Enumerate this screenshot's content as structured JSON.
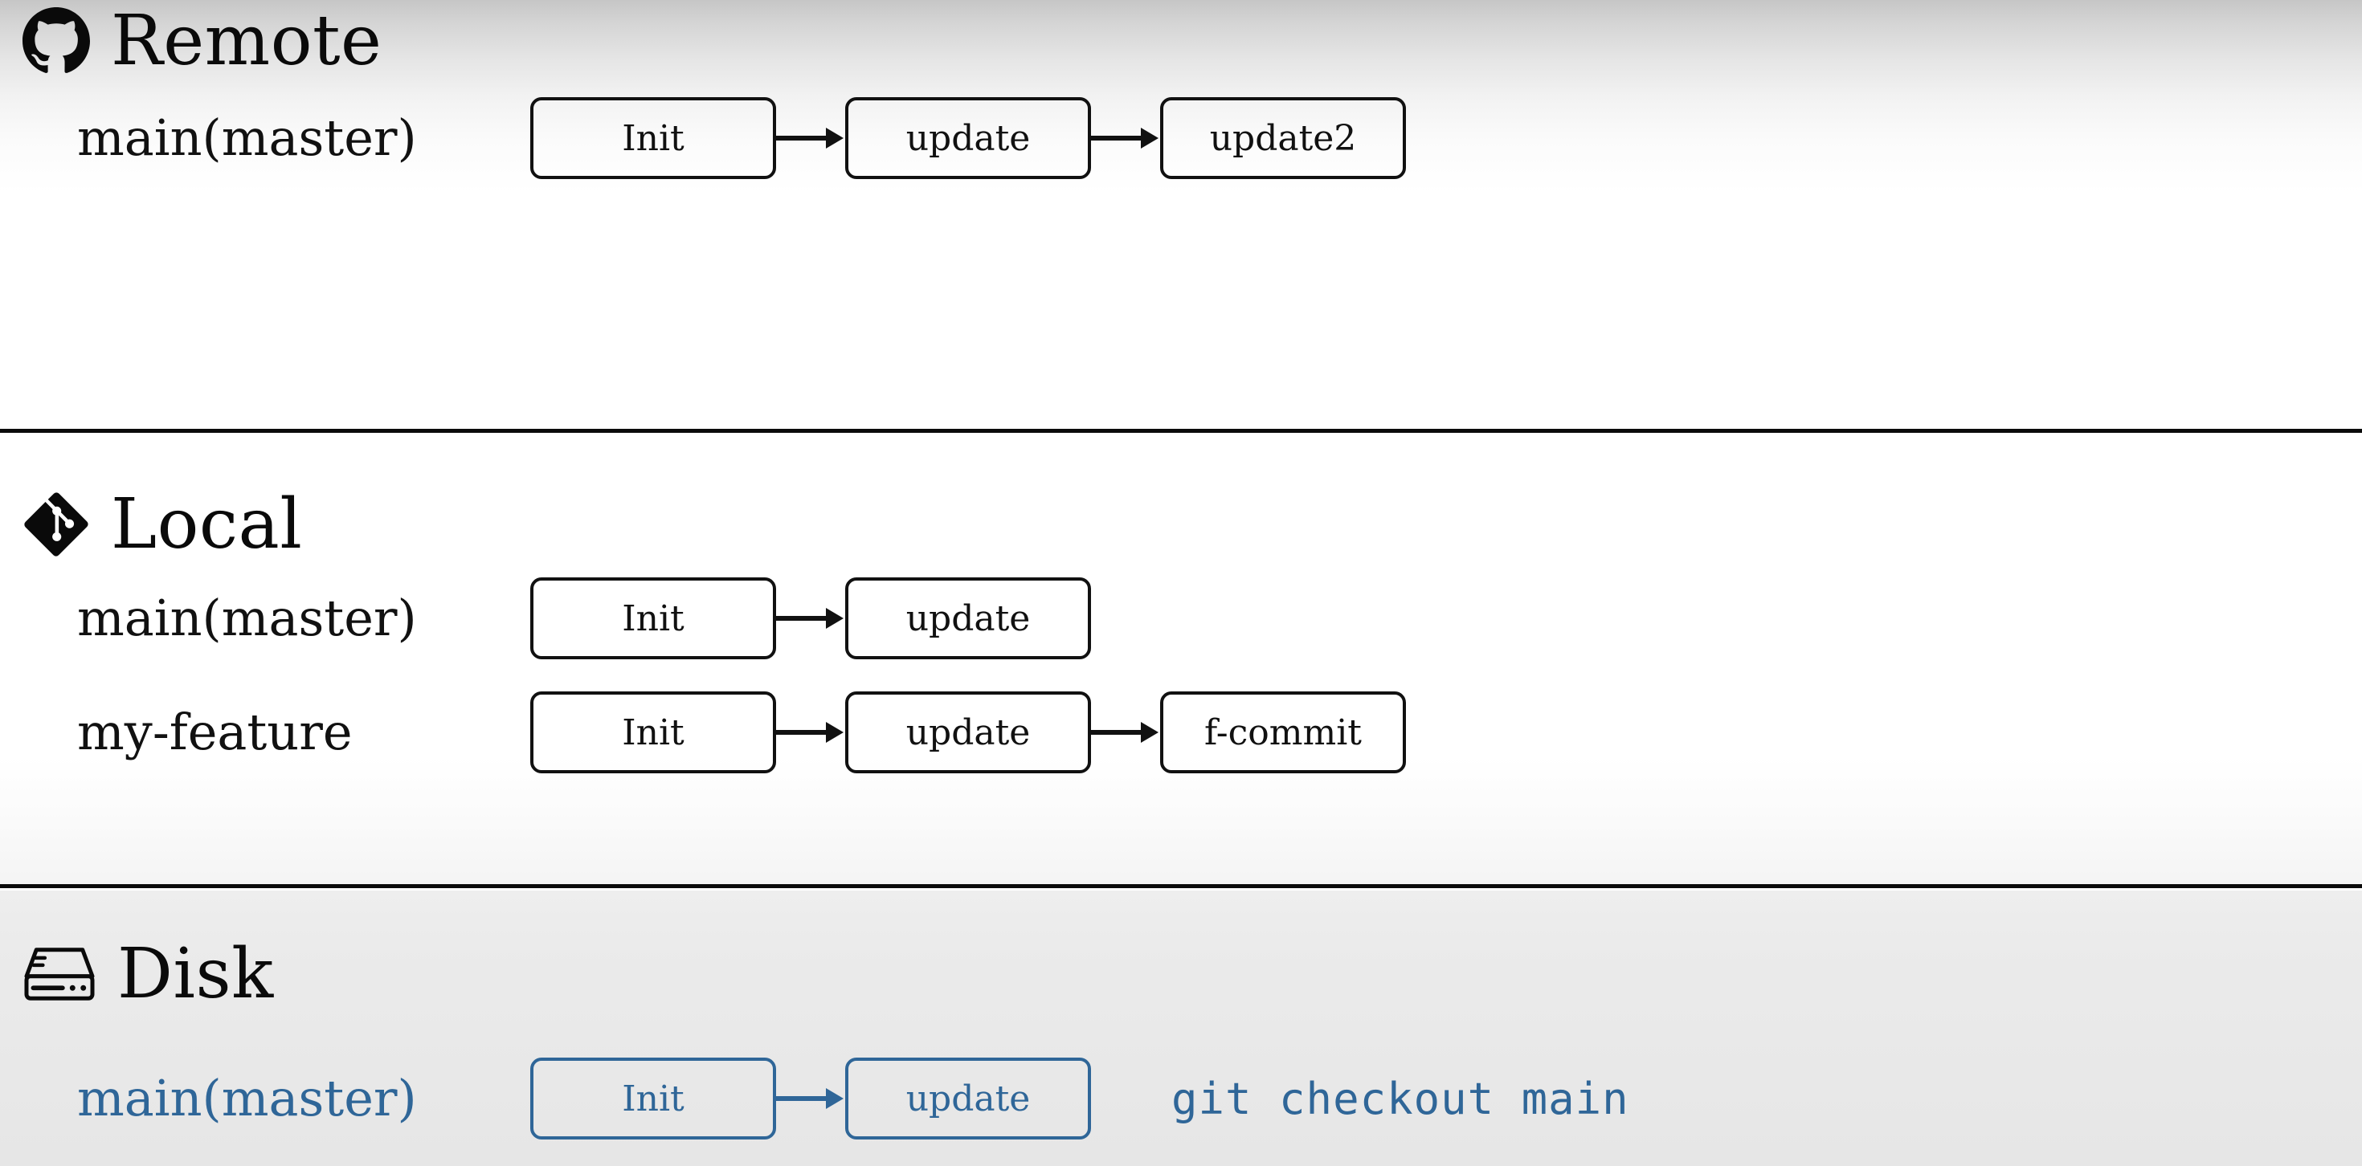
{
  "sections": [
    {
      "id": "remote",
      "title": "Remote",
      "icon": "github-octocat-icon",
      "rows": [
        {
          "label": "main(master)",
          "commits": [
            "Init",
            "update",
            "update2"
          ]
        }
      ]
    },
    {
      "id": "local",
      "title": "Local",
      "icon": "git-logo-icon",
      "rows": [
        {
          "label": "main(master)",
          "commits": [
            "Init",
            "update"
          ]
        },
        {
          "label": "my-feature",
          "commits": [
            "Init",
            "update",
            "f-commit"
          ]
        }
      ]
    },
    {
      "id": "disk",
      "title": "Disk",
      "icon": "hard-drive-icon",
      "rows": [
        {
          "label": "main(master)",
          "commits": [
            "Init",
            "update"
          ],
          "command": "git checkout main"
        }
      ]
    }
  ],
  "colors": {
    "ink": "#111111",
    "accent_blue": "#2f6698",
    "divider": "#0b0b0b"
  }
}
